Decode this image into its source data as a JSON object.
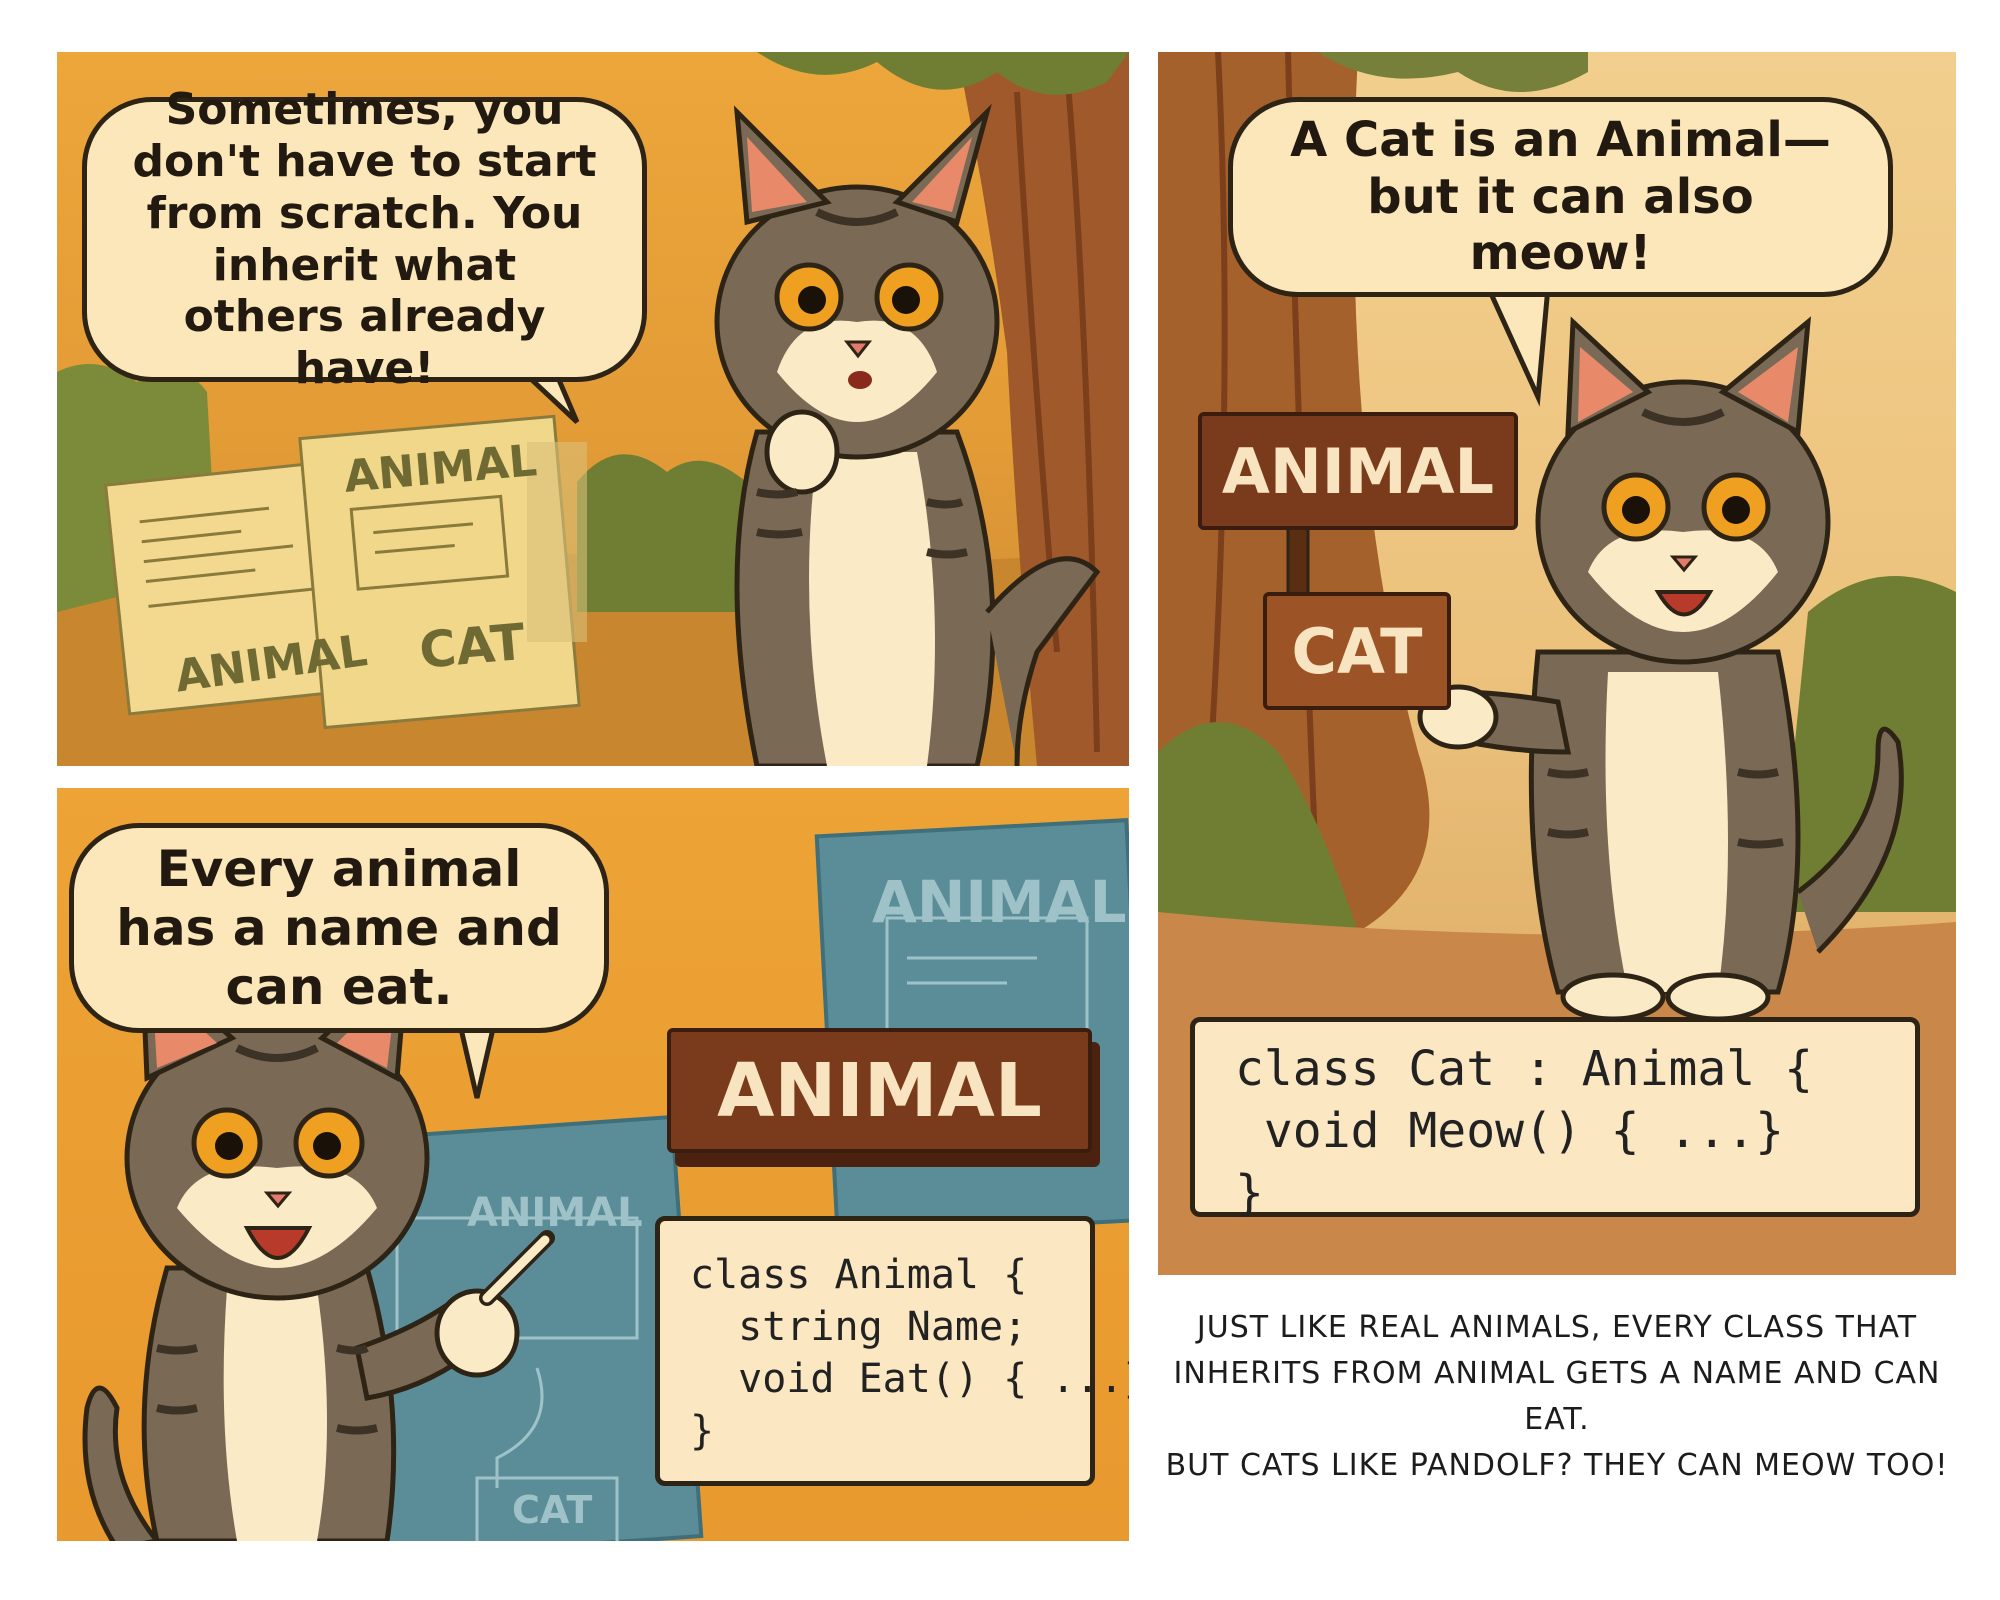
{
  "panel1": {
    "bubble": "Sometimes, you don't have to start from scratch. You inherit what others already have!",
    "papers": {
      "left_label": "ANIMAL",
      "center_label": "ANIMAL",
      "center_bottom_label": "CAT"
    }
  },
  "panel2": {
    "bubble": "A Cat is an Animal— but it can also meow!",
    "sign_animal": "ANIMAL",
    "sign_cat": "CAT",
    "code": "class Cat : Animal {\n void Meow() { ...}\n}"
  },
  "panel3": {
    "bubble": "Every animal has a name and can eat.",
    "sign_animal": "ANIMAL",
    "blueprint_top_label": "ANIMAL",
    "blueprint_left_label": "ANIMAL",
    "blueprint_bottom_label": "CAT",
    "code": "class Animal {\n  string Name;\n  void Eat() { ...}\n}"
  },
  "caption": "Just like real animals, every class that inherits from Animal gets a name and can eat.\nBut cats like Pandolf? They can meow too!",
  "colors": {
    "bubble_fill": "#fbe7b9",
    "outline": "#2e2416",
    "sign_brown": "#7a3b1c",
    "cat_fur": "#7a6a55",
    "cat_eye": "#f0a020",
    "blueprint": "#5b8d99"
  }
}
